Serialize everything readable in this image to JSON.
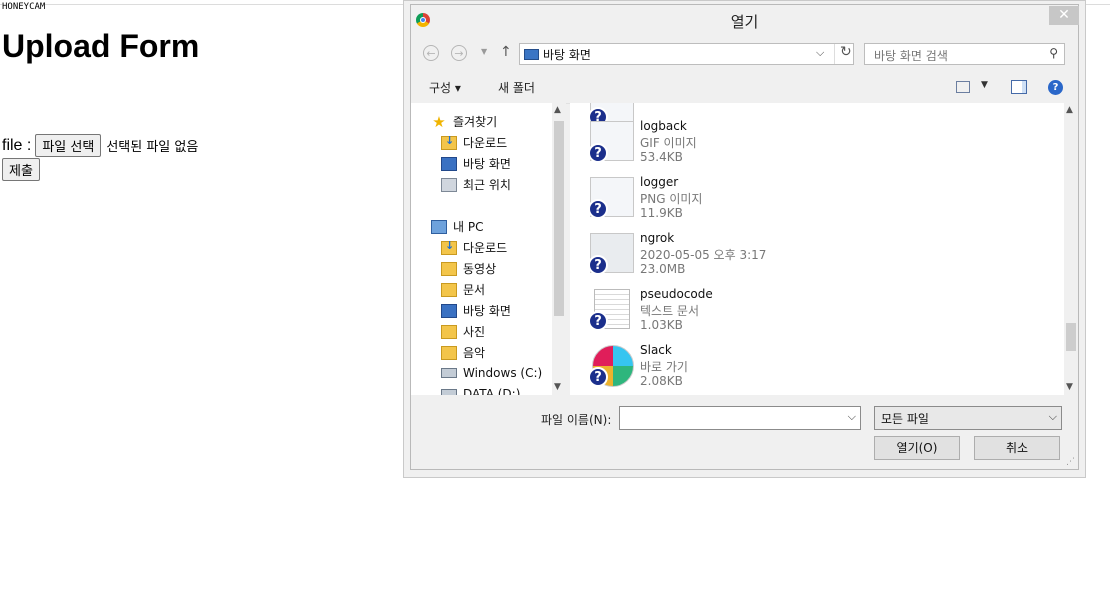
{
  "watermark": "HONEYCAM",
  "page": {
    "title": "Upload Form",
    "file_label": "file :",
    "choose_button": "파일 선택",
    "no_file_text": "선택된 파일 없음",
    "submit_button": "제출"
  },
  "dialog": {
    "title": "열기",
    "close_glyph": "✕",
    "address": "바탕 화면",
    "search_placeholder": "바탕 화면 검색",
    "toolbar": {
      "organize": "구성 ▾",
      "new_folder": "새 폴더"
    },
    "sidebar": {
      "favorites": "즐겨찾기",
      "fav_downloads": "다운로드",
      "fav_desktop": "바탕 화면",
      "fav_recent": "최근 위치",
      "this_pc": "내 PC",
      "pc_downloads": "다운로드",
      "pc_videos": "동영상",
      "pc_documents": "문서",
      "pc_desktop": "바탕 화면",
      "pc_pictures": "사진",
      "pc_music": "음악",
      "drive_c": "Windows (C:)",
      "drive_d": "DATA (D:)"
    },
    "files": [
      {
        "name": "logback",
        "type": "GIF 이미지",
        "size": "53.4KB"
      },
      {
        "name": "logger",
        "type": "PNG 이미지",
        "size": "11.9KB"
      },
      {
        "name": "ngrok",
        "type": "2020-05-05 오후 3:17",
        "size": "23.0MB"
      },
      {
        "name": "pseudocode",
        "type": "텍스트 문서",
        "size": "1.03KB"
      },
      {
        "name": "Slack",
        "type": "바로 가기",
        "size": "2.08KB"
      }
    ],
    "filename_label": "파일 이름(N):",
    "filename_value": "",
    "filter_value": "모든 파일",
    "open_button": "열기(O)",
    "cancel_button": "취소"
  }
}
